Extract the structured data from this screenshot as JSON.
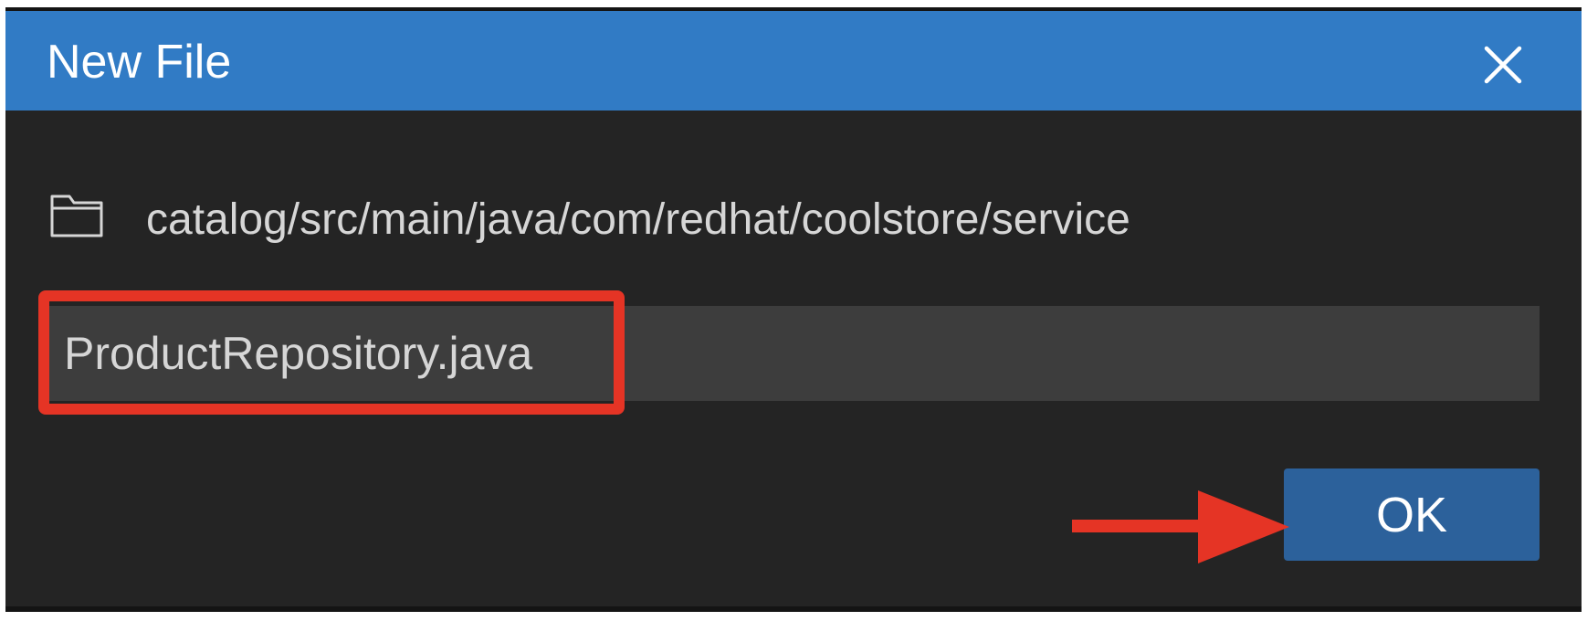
{
  "dialog": {
    "title": "New File",
    "close_icon": "close-icon",
    "folder_icon": "folder-icon",
    "path": "catalog/src/main/java/com/redhat/coolstore/service",
    "filename_value": "ProductRepository.java",
    "ok_label": "OK"
  },
  "annotations": {
    "highlight_color": "#e53425",
    "arrow_color": "#e53425"
  },
  "colors": {
    "titlebar": "#317bc5",
    "dialog_bg": "#242424",
    "input_bg": "#3d3d3d",
    "ok_button": "#2c619b"
  }
}
